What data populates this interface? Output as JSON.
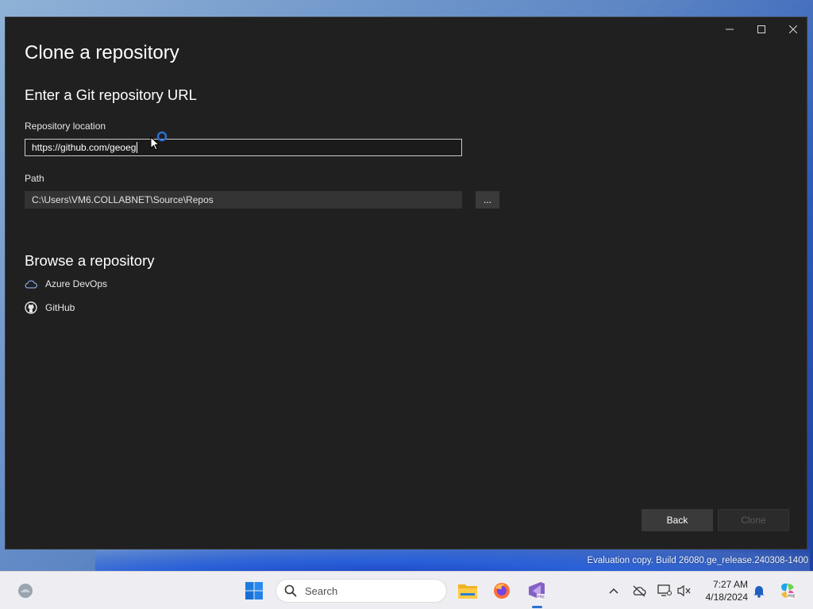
{
  "window": {
    "title": "Clone a repository",
    "controls": {
      "minimize": "minimize",
      "maximize": "maximize",
      "close": "close"
    }
  },
  "git_url_section": {
    "heading": "Enter a Git repository URL",
    "repository_location": {
      "label": "Repository location",
      "value": "https://github.com/geoeg"
    },
    "path": {
      "label": "Path",
      "value": "C:\\Users\\VM6.COLLABNET\\Source\\Repos",
      "browse_label": "..."
    }
  },
  "browse_section": {
    "heading": "Browse a repository",
    "providers": [
      {
        "label": "Azure DevOps",
        "icon": "cloud-icon"
      },
      {
        "label": "GitHub",
        "icon": "github-icon"
      }
    ]
  },
  "footer": {
    "back_label": "Back",
    "clone_label": "Clone",
    "clone_enabled": false
  },
  "desktop": {
    "watermark": "Evaluation copy. Build 26080.ge_release.240308-1400"
  },
  "taskbar": {
    "search_placeholder": "Search",
    "clock_time": "7:27 AM",
    "clock_date": "4/18/2024",
    "apps": [
      "widgets-icon",
      "windows-start-icon",
      "file-explorer-icon",
      "firefox-icon",
      "visual-studio-preview-icon"
    ]
  },
  "colors": {
    "dialog_bg": "#202020",
    "accent": "#2a6fd6",
    "taskbar_bg": "#eeeef2"
  }
}
